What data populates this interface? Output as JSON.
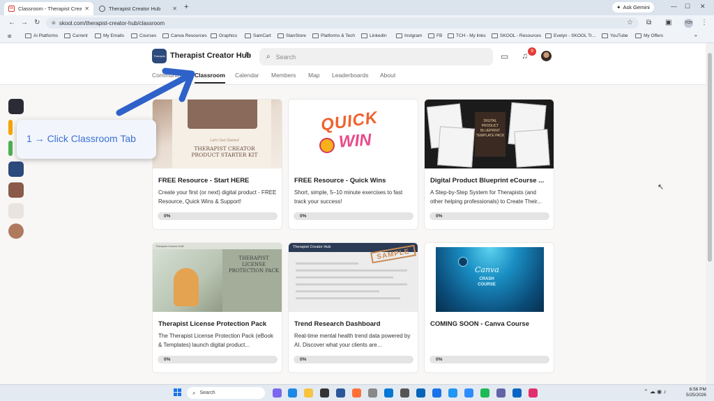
{
  "browser": {
    "tabs": [
      {
        "title": "Classroom - Therapist Creator Hub",
        "active": true
      },
      {
        "title": "Therapist Creator Hub",
        "active": false
      }
    ],
    "new_tab": "+",
    "ask_gemini": "Ask Gemini",
    "url": "skool.com/therapist-creator-hub/classroom",
    "profile_badge": "TCH",
    "bookmarks": [
      "Ai Platforms",
      "Current",
      "My Emails",
      "Courses",
      "Canva Resources",
      "Graphics",
      "SamCart",
      "StanStore",
      "Platforms & Tech",
      "LinkedIn",
      "Instgram",
      "FB",
      "TCH - My links",
      "SKOOL - Resources",
      "Evelyn - SKOOL Tr...",
      "YouTube",
      "My Offers"
    ]
  },
  "header": {
    "logo_text": "Therapist Creator Hub",
    "group_name": "Therapist Creator Hub",
    "search_placeholder": "Search",
    "notification_count": "9"
  },
  "nav": {
    "tabs": [
      "Community",
      "Classroom",
      "Calendar",
      "Members",
      "Map",
      "Leaderboards",
      "About"
    ],
    "active": "Classroom"
  },
  "tutorial": {
    "callout": "1 → Click Classroom Tab"
  },
  "courses": [
    {
      "title": "FREE Resource - Start HERE",
      "description": "Create your first (or next) digital product - FREE Resource, Quick Wins & Support!",
      "progress": "0%",
      "progress_value": 0,
      "thumb_subtitle": "Let's Get Started",
      "thumb_title": "THERAPIST CREATOR PRODUCT STARTER KIT"
    },
    {
      "title": "FREE Resource - Quick Wins",
      "description": "Short, simple, 5–10 minute exercises to fast track your success!",
      "progress": "0%",
      "progress_value": 0,
      "thumb_word1": "QUICK",
      "thumb_word2": "WIN"
    },
    {
      "title": "Digital Product Blueprint eCourse ...",
      "description": "A Step-by-Step System for Therapists (and other helping professionals) to Create Their...",
      "progress": "0%",
      "progress_value": 0,
      "thumb_title": "DIGITAL PRODUCT BLUEPRINT TEMPLATE PACK"
    },
    {
      "title": "Therapist License Protection Pack",
      "description": "The Therapist License Protection Pack (eBook & Templates) launch digital product...",
      "progress": "0%",
      "progress_value": 0,
      "thumb_topbar": "Therapist Creator HUB",
      "thumb_title": "THERAPIST LICENSE PROTECTION PACK"
    },
    {
      "title": "Trend Research Dashboard",
      "description": "Real-time mental health trend data powered by AI. Discover what your clients are...",
      "progress": "0%",
      "progress_value": 0,
      "thumb_header": "Therapist Creator Hub",
      "thumb_stamp": "SAMPLE"
    },
    {
      "title": "COMING SOON - Canva Course",
      "description": "",
      "progress": "0%",
      "progress_value": 0,
      "thumb_title": "Canva",
      "thumb_sub": "CRASH COURSE"
    }
  ],
  "taskbar": {
    "search_placeholder": "Search",
    "time": "6:56 PM",
    "date": "5/25/2026"
  },
  "colors": {
    "accent": "#3b6fd4",
    "arrow": "#2f62c9",
    "badge": "#e53935",
    "progress_track": "#e4e4e4"
  }
}
